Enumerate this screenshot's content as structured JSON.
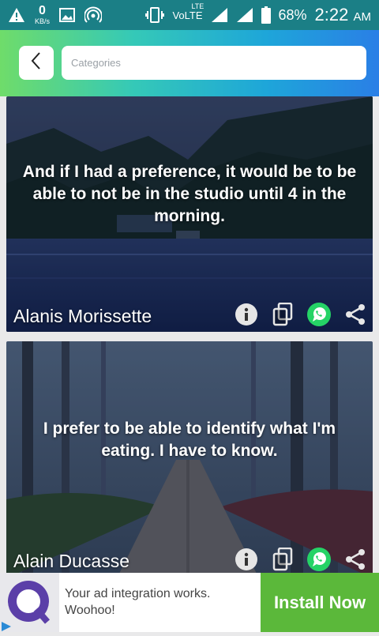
{
  "status_bar": {
    "net_speed": "0",
    "net_unit": "KB/s",
    "network_label": "VoLTE",
    "lte_label": "LTE",
    "battery": "68%",
    "time": "2:22",
    "ampm": "AM",
    "icons": [
      "alert-icon",
      "image-icon",
      "hotspot-icon",
      "vibrate-icon",
      "signal-icon",
      "battery-icon"
    ]
  },
  "header": {
    "back_icon": "chevron-left-icon",
    "search_placeholder": "Categories"
  },
  "quotes": [
    {
      "text": "And if I had a preference, it would be to be able to not be in the studio until 4 in the morning.",
      "author": "Alanis Morissette",
      "background": "lake-forest"
    },
    {
      "text": "I prefer to be able to identify what I'm eating. I have to know.",
      "author": "Alain Ducasse",
      "background": "forest-path"
    }
  ],
  "actions": [
    "info-icon",
    "copy-icon",
    "whatsapp-icon",
    "share-icon"
  ],
  "ad": {
    "text": "Your ad integration works. Woohoo!",
    "button": "Install Now",
    "colors": {
      "button": "#5bb83a"
    }
  },
  "colors": {
    "status_bar": "#1b7f86",
    "whatsapp": "#25d366"
  }
}
